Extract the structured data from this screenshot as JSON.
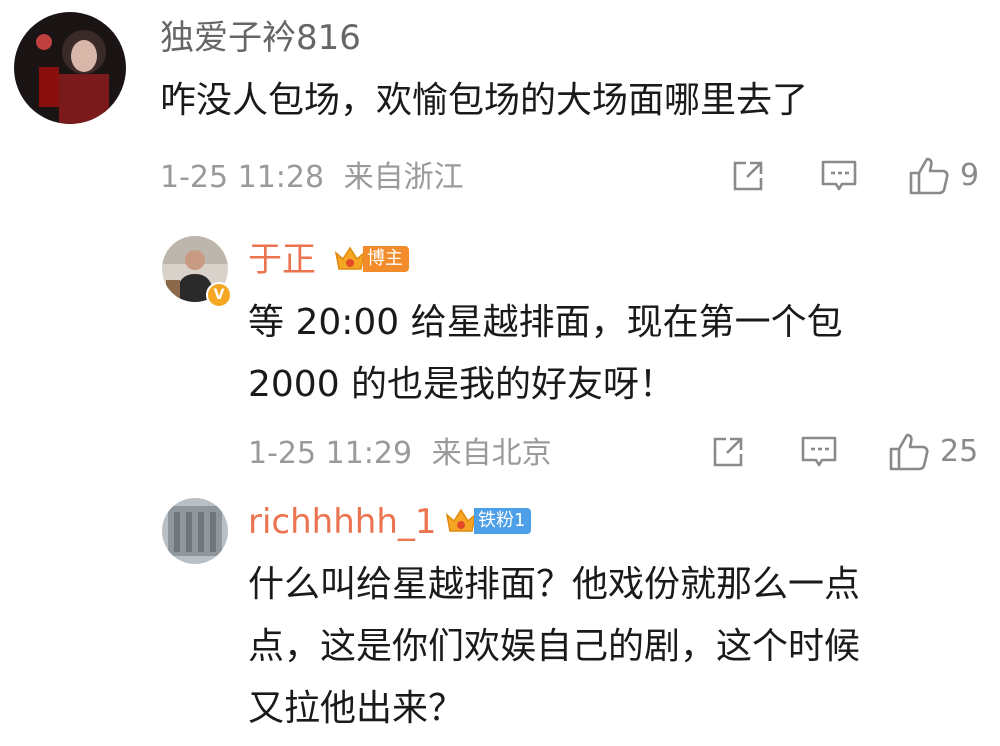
{
  "comments": [
    {
      "username": "独爱子衿816",
      "text": "咋没人包场，欢愉包场的大场面哪里去了",
      "time": "1-25 11:28",
      "location": "来自浙江",
      "like_count": "9"
    },
    {
      "username": "于正",
      "badge": "博主",
      "verified_mark": "V",
      "text": "等 20:00 给星越排面，现在第一个包\n2000 的也是我的好友呀！",
      "time": "1-25 11:29",
      "location": "来自北京",
      "like_count": "25"
    },
    {
      "username": "richhhhh_1",
      "badge": "铁粉1",
      "text": "什么叫给星越排面？他戏份就那么一点\n点，这是你们欢娱自己的剧，这个时候\n又拉他出来？"
    }
  ],
  "icons": {
    "share": "share-icon",
    "comment": "comment-icon",
    "like": "like-icon",
    "crown": "crown-icon"
  },
  "colors": {
    "username_gray": "#666666",
    "username_orange": "#eb7350",
    "meta_gray": "#9a9a9a",
    "host_badge": "#f28b2a",
    "fan_badge": "#4d9fe8"
  }
}
